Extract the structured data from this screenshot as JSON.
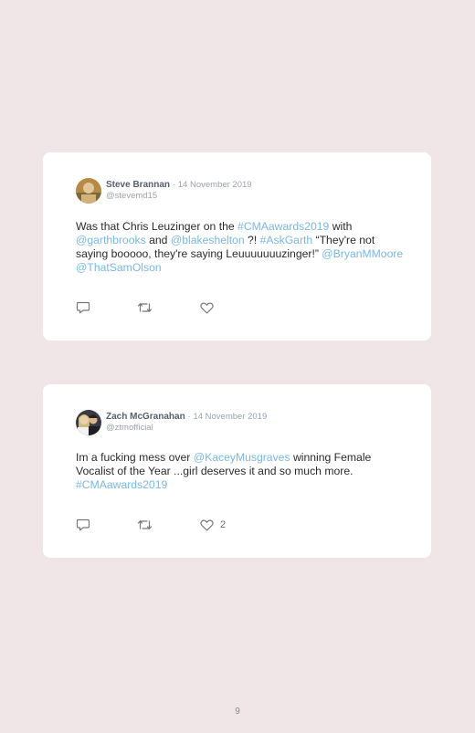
{
  "tweets": [
    {
      "name": "Steve Brannan",
      "date": "14 November 2019",
      "handle": "@stevemd15",
      "segments": [
        {
          "text": "Was that Chris Leuzinger on the ",
          "link": false
        },
        {
          "text": "#CMAawards2019",
          "link": true
        },
        {
          "text": " with ",
          "link": false
        },
        {
          "text": "@garthbrooks",
          "link": true
        },
        {
          "text": " and ",
          "link": false
        },
        {
          "text": "@blakeshelton",
          "link": true
        },
        {
          "text": " ?! ",
          "link": false
        },
        {
          "text": "#AskGarth",
          "link": true
        },
        {
          "text": " “They're not saying booooo, they're saying Leuuuuuuuzinger!” ",
          "link": false
        },
        {
          "text": "@BryanMMoore",
          "link": true
        },
        {
          "text": " ",
          "link": false
        },
        {
          "text": "@ThatSamOlson",
          "link": true
        }
      ],
      "likes": ""
    },
    {
      "name": "Zach McGranahan",
      "date": "14 November 2019",
      "handle": "@ztmofficial",
      "segments": [
        {
          "text": "Im a fucking mess over ",
          "link": false
        },
        {
          "text": "@KaceyMusgraves",
          "link": true
        },
        {
          "text": " winning Female Vocalist of the Year ...girl deserves it and so much more. ",
          "link": false
        },
        {
          "text": "#CMAawards2019",
          "link": true
        }
      ],
      "likes": "2"
    }
  ],
  "separator": "·",
  "icons": {
    "reply": "reply-icon",
    "retweet": "retweet-icon",
    "like": "heart-icon"
  },
  "colors": {
    "background": "#f0e6e8",
    "card": "#ffffff",
    "link": "#7cb7e0",
    "muted": "#9aa3ad"
  },
  "page_number": "9"
}
